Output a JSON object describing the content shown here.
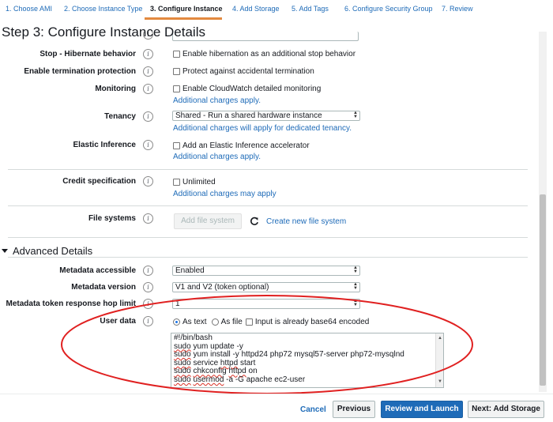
{
  "wizard": {
    "tabs": [
      {
        "label": "1. Choose AMI"
      },
      {
        "label": "2. Choose Instance Type"
      },
      {
        "label": "3. Configure Instance"
      },
      {
        "label": "4. Add Storage"
      },
      {
        "label": "5. Add Tags"
      },
      {
        "label": "6. Configure Security Group"
      },
      {
        "label": "7. Review"
      }
    ],
    "active_tab": "3. Configure Instance",
    "accent_color": "#e3893f"
  },
  "page": {
    "title": "Step 3: Configure Instance Details"
  },
  "rows": {
    "stop_hibernate": {
      "label": "Stop - Hibernate behavior",
      "checkbox": "Enable hibernation as an additional stop behavior"
    },
    "termination": {
      "label": "Enable termination protection",
      "checkbox": "Protect against accidental termination"
    },
    "monitoring": {
      "label": "Monitoring",
      "checkbox": "Enable CloudWatch detailed monitoring",
      "link": "Additional charges apply."
    },
    "tenancy": {
      "label": "Tenancy",
      "select": "Shared - Run a shared hardware instance",
      "link": "Additional charges will apply for dedicated tenancy."
    },
    "elastic_inference": {
      "label": "Elastic Inference",
      "checkbox": "Add an Elastic Inference accelerator",
      "link": "Additional charges apply."
    },
    "credit": {
      "label": "Credit specification",
      "checkbox": "Unlimited",
      "link": "Additional charges may apply"
    },
    "file_systems": {
      "label": "File systems",
      "button": "Add file system",
      "link": "Create new file system"
    }
  },
  "advanced": {
    "title": "Advanced Details",
    "metadata_accessible": {
      "label": "Metadata accessible",
      "select": "Enabled"
    },
    "metadata_version": {
      "label": "Metadata version",
      "select": "V1 and V2 (token optional)"
    },
    "hop_limit": {
      "label": "Metadata token response hop limit",
      "select": "1"
    },
    "user_data": {
      "label": "User data",
      "radio_text": "As text",
      "radio_file": "As file",
      "base64_checkbox": "Input is already base64 encoded",
      "lines": [
        "#!/bin/bash",
        "sudo yum update -y",
        "sudo yum install -y httpd24 php72 mysql57-server php72-mysqlnd",
        "sudo service httpd start",
        "sudo chkconfig httpd on",
        "sudo usermod -a -G apache ec2-user"
      ]
    }
  },
  "footer": {
    "cancel": "Cancel",
    "previous": "Previous",
    "review_launch": "Review and Launch",
    "next": "Next: Add Storage"
  },
  "colors": {
    "link": "#1e6bb8",
    "primary_button": "#1e6bb8",
    "annotation": "#e02020"
  }
}
